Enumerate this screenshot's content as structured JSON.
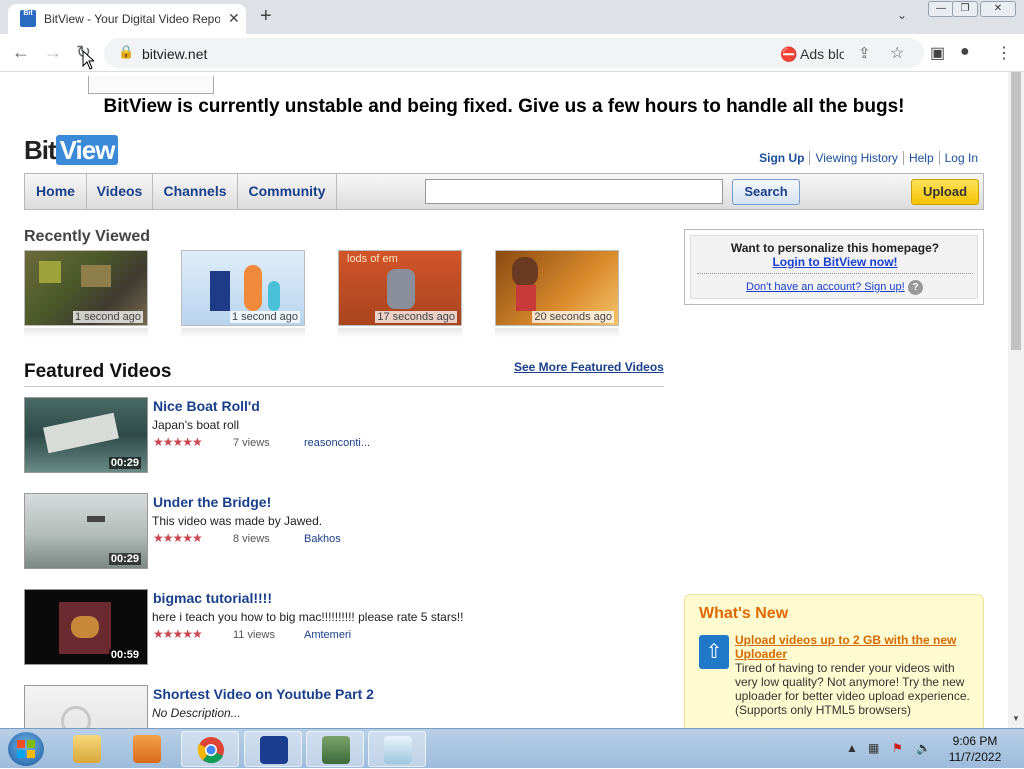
{
  "browser": {
    "tab_title": "BitView - Your Digital Video Repository",
    "favicon_text": "Bit",
    "url": "bitview.net",
    "extension_label": "Ads blocked"
  },
  "page": {
    "banner": "BitView is currently unstable and being fixed. Give us a few hours to handle all the bugs!",
    "logo": {
      "part1": "Bit",
      "part2": "View"
    },
    "user_links": [
      "Sign Up",
      "Viewing History",
      "Help",
      "Log In"
    ],
    "nav": [
      "Home",
      "Videos",
      "Channels",
      "Community"
    ],
    "search_button": "Search",
    "upload_button": "Upload",
    "recently_viewed": {
      "title": "Recently Viewed",
      "items": [
        {
          "time": "1 second ago"
        },
        {
          "time": "1 second ago"
        },
        {
          "time": "17 seconds ago",
          "overlay": "lods of em"
        },
        {
          "time": "20 seconds ago"
        }
      ]
    },
    "personalize": {
      "question": "Want to personalize this homepage?",
      "login": "Login to BitView now!",
      "signup": "Don't have an account? Sign up!",
      "help": "?"
    },
    "featured": {
      "title": "Featured Videos",
      "more": "See More Featured Videos",
      "videos": [
        {
          "title": "Nice Boat Roll'd",
          "desc": "Japan's boat roll",
          "views": "7 views",
          "user": "reasonconti...",
          "duration": "00:29",
          "stars": "★★★★★"
        },
        {
          "title": "Under the Bridge!",
          "desc": "This video was made by Jawed.",
          "views": "8 views",
          "user": "Bakhos",
          "duration": "00:29",
          "stars": "★★★★★"
        },
        {
          "title": "bigmac tutorial!!!!",
          "desc": "here i teach you how to big mac!!!!!!!!!! please rate 5 stars!!",
          "views": "11 views",
          "user": "Amtemeri",
          "duration": "00:59",
          "stars": "★★★★★"
        },
        {
          "title": "Shortest Video on Youtube Part 2",
          "desc": "No Description...",
          "views": "",
          "user": "",
          "duration": "",
          "stars": ""
        }
      ]
    },
    "whats_new": {
      "title": "What's New",
      "link": "Upload videos up to 2 GB with the new Uploader",
      "body": "Tired of having to render your videos with very low quality? Not anymore! Try the new uploader for better video upload experience. (Supports only HTML5 browsers)"
    }
  },
  "taskbar": {
    "time": "9:06 PM",
    "date": "11/7/2022"
  },
  "colors": {
    "link": "#1a3f8a",
    "accent_orange": "#e06a00",
    "stars": "#c9454e",
    "upload_yellow": "#f5c400"
  }
}
